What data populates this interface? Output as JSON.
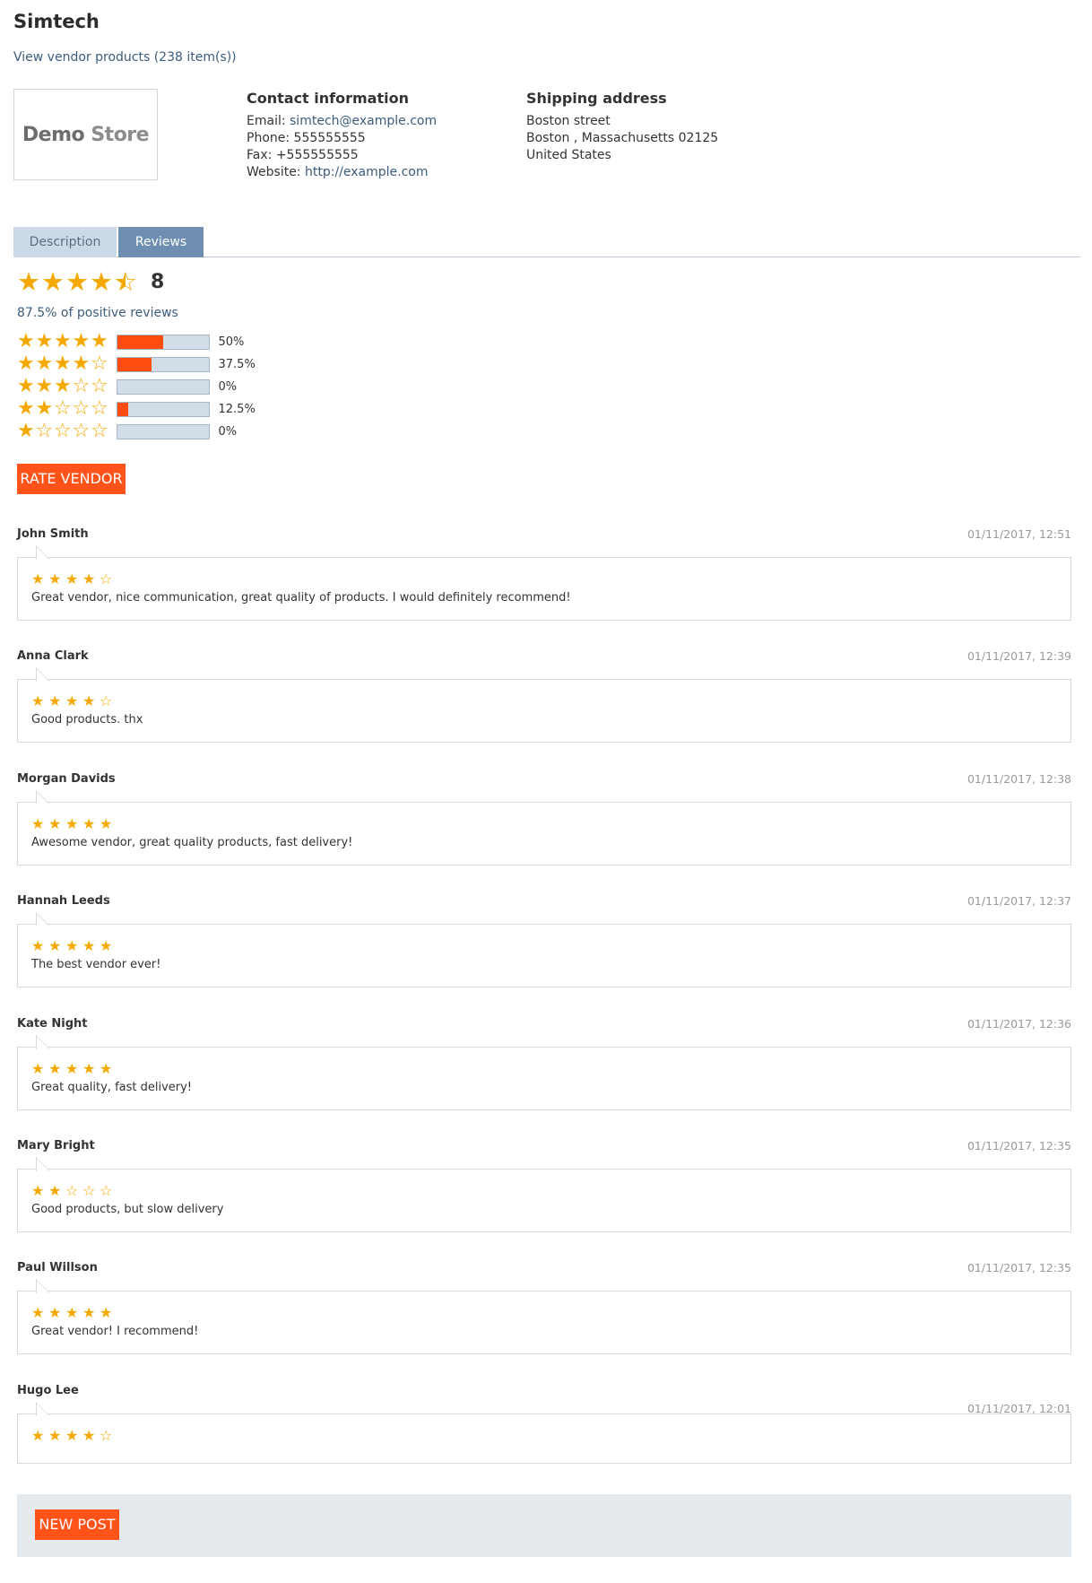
{
  "vendor": {
    "name": "Simtech",
    "products_link": "View vendor products (238 item(s))",
    "logo": {
      "word1": "Demo",
      "word2": "Store"
    }
  },
  "contact": {
    "title": "Contact information",
    "email_label": "Email:",
    "email": "simtech@example.com",
    "phone_label": "Phone:",
    "phone": "555555555",
    "fax_label": "Fax:",
    "fax": "+555555555",
    "website_label": "Website:",
    "website": "http://example.com"
  },
  "shipping": {
    "title": "Shipping address",
    "line1": "Boston street",
    "line2": "Boston , Massachusetts 02125",
    "line3": "United States"
  },
  "tabs": [
    {
      "label": "Description",
      "active": false
    },
    {
      "label": "Reviews",
      "active": true
    }
  ],
  "rating_summary": {
    "average_stars": 4.5,
    "count": "8",
    "positive_text": "87.5% of positive reviews",
    "distribution": [
      {
        "stars": 5,
        "percent": 50,
        "label": "50%"
      },
      {
        "stars": 4,
        "percent": 37.5,
        "label": "37.5%"
      },
      {
        "stars": 3,
        "percent": 0,
        "label": "0%"
      },
      {
        "stars": 2,
        "percent": 12.5,
        "label": "12.5%"
      },
      {
        "stars": 1,
        "percent": 0,
        "label": "0%"
      }
    ]
  },
  "buttons": {
    "rate_vendor": "RATE VENDOR",
    "new_post": "NEW POST"
  },
  "reviews": [
    {
      "author": "John Smith",
      "date": "01/11/2017, 12:51",
      "rating": 4,
      "text": "Great vendor, nice communication, great quality of products. I would definitely recommend!"
    },
    {
      "author": "Anna Clark",
      "date": "01/11/2017, 12:39",
      "rating": 4,
      "text": "Good products. thx"
    },
    {
      "author": "Morgan Davids",
      "date": "01/11/2017, 12:38",
      "rating": 5,
      "text": "Awesome vendor, great quality products, fast delivery!"
    },
    {
      "author": "Hannah Leeds",
      "date": "01/11/2017, 12:37",
      "rating": 5,
      "text": "The best vendor ever!"
    },
    {
      "author": "Kate Night",
      "date": "01/11/2017, 12:36",
      "rating": 5,
      "text": "Great quality, fast delivery!"
    },
    {
      "author": "Mary Bright",
      "date": "01/11/2017, 12:35",
      "rating": 2,
      "text": "Good products, but slow delivery"
    },
    {
      "author": "Paul Willson",
      "date": "01/11/2017, 12:35",
      "rating": 5,
      "text": "Great vendor! I recommend!"
    },
    {
      "author": "Hugo Lee",
      "date": "01/11/2017, 12:01",
      "rating": 4,
      "text": ""
    }
  ],
  "colors": {
    "star": "#f5a800",
    "accent": "#ff5319",
    "bar_fill": "#ff4d0f",
    "tab_active": "#6e8fb1",
    "tab_inactive": "#ccd9e6"
  }
}
